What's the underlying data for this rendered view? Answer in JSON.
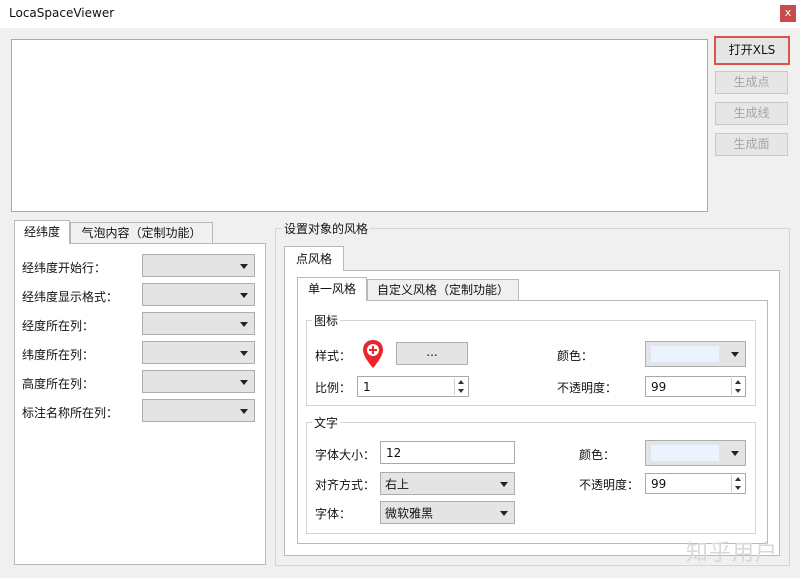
{
  "window": {
    "title": "LocaSpaceViewer",
    "close_label": "x"
  },
  "buttons": {
    "open_xls": "打开XLS",
    "gen_point": "生成点",
    "gen_line": "生成线",
    "gen_polygon": "生成面"
  },
  "left_tabs": {
    "tab1": "经纬度",
    "tab2": "气泡内容（定制功能）"
  },
  "coord_fields": [
    {
      "label": "经纬度开始行：",
      "value": ""
    },
    {
      "label": "经纬度显示格式：",
      "value": ""
    },
    {
      "label": "经度所在列：",
      "value": ""
    },
    {
      "label": "纬度所在列：",
      "value": ""
    },
    {
      "label": "高度所在列：",
      "value": ""
    },
    {
      "label": "标注名称所在列：",
      "value": ""
    }
  ],
  "style_group": {
    "title": "设置对象的风格",
    "outer_tab": "点风格",
    "inner_tabs": {
      "single": "单一风格",
      "custom": "自定义风格（定制功能）"
    },
    "icon_section": {
      "title": "图标",
      "style_label": "样式：",
      "browse_label": "...",
      "color_label": "颜色：",
      "scale_label": "比例：",
      "scale_value": "1",
      "opacity_label": "不透明度：",
      "opacity_value": "99",
      "marker_color": "#e8262b",
      "icon_color": "#ecf3ff"
    },
    "text_section": {
      "title": "文字",
      "font_size_label": "字体大小：",
      "font_size_value": "12",
      "color_label": "颜色：",
      "align_label": "对齐方式：",
      "align_value": "右上",
      "opacity_label": "不透明度：",
      "opacity_value": "99",
      "font_label": "字体：",
      "font_value": "微软雅黑",
      "text_color": "#ecf3ff"
    }
  },
  "watermark": "知乎用户"
}
